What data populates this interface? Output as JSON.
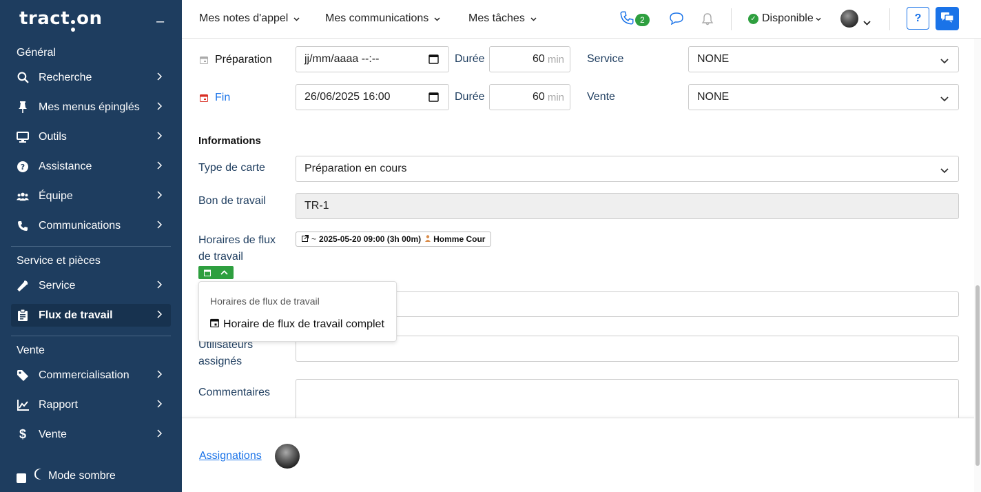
{
  "brand": {
    "logo_pre": "tract",
    "logo_post": "on"
  },
  "sidebar": {
    "sections": [
      {
        "title": "Général",
        "items": [
          {
            "label": "Recherche",
            "icon": "search-icon"
          },
          {
            "label": "Mes menus épinglés",
            "icon": "pin-icon"
          },
          {
            "label": "Outils",
            "icon": "monitor-icon"
          },
          {
            "label": "Assistance",
            "icon": "help-icon"
          },
          {
            "label": "Équipe",
            "icon": "team-icon"
          },
          {
            "label": "Communications",
            "icon": "phone-icon"
          }
        ]
      },
      {
        "title": "Service et pièces",
        "items": [
          {
            "label": "Service",
            "icon": "wrench-icon"
          },
          {
            "label": "Flux de travail",
            "icon": "clipboard-icon",
            "active": true
          }
        ]
      },
      {
        "title": "Vente",
        "items": [
          {
            "label": "Commercialisation",
            "icon": "tag-icon"
          },
          {
            "label": "Rapport",
            "icon": "chart-icon"
          },
          {
            "label": "Vente",
            "icon": "dollar-icon"
          }
        ]
      }
    ],
    "dark_mode_label": "Mode sombre"
  },
  "header": {
    "nav": [
      "Mes notes d'appel",
      "Mes communications",
      "Mes tâches"
    ],
    "call_count": "2",
    "status": "Disponible",
    "help": "?"
  },
  "form": {
    "preparation_label": "Préparation",
    "preparation_value": "jj/mm/aaaa --:--",
    "fin_label": "Fin",
    "fin_value": "26/06/2025 16:00",
    "duree_label": "Durée",
    "duree_prep": "60",
    "duree_fin": "60",
    "unit": "min",
    "service_label": "Service",
    "service_value": "NONE",
    "vente_label": "Vente",
    "vente_value": "NONE",
    "informations_heading": "Informations",
    "type_carte_label": "Type de carte",
    "type_carte_value": "Préparation en cours",
    "bon_travail_label": "Bon de travail",
    "bon_travail_value": "TR-1",
    "horaires_label_1": "Horaires de flux",
    "horaires_label_2": "de travail",
    "schedule_chip": "2025-05-20 09:00 (3h 00m)",
    "schedule_user": "Homme Cour",
    "popup_title": "Horaires de flux de travail",
    "popup_item": "Horaire de flux de travail complet",
    "utilisateurs_label_1": "Utilisateurs",
    "utilisateurs_label_2": "assignés",
    "commentaires_label": "Commentaires"
  },
  "footer": {
    "assign_link": "Assignations"
  },
  "colors": {
    "sidebar_bg": "#1e3d5f",
    "accent": "#1a73e8",
    "success": "#2e9f3f",
    "danger": "#d93025"
  }
}
